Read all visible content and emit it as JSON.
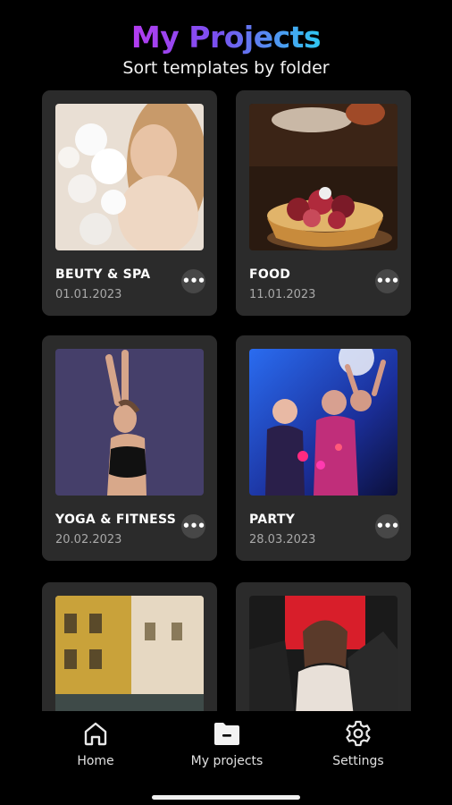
{
  "header": {
    "title": "My Projects",
    "subtitle": "Sort templates by folder"
  },
  "projects": [
    {
      "name": "BEUTY & SPA",
      "date": "01.01.2023",
      "more_icon": "more-horizontal-icon"
    },
    {
      "name": "FOOD",
      "date": "11.01.2023",
      "more_icon": "more-horizontal-icon"
    },
    {
      "name": "YOGA & FITNESS",
      "date": "20.02.2023",
      "more_icon": "more-horizontal-icon"
    },
    {
      "name": "PARTY",
      "date": "28.03.2023",
      "more_icon": "more-horizontal-icon"
    },
    {
      "name": "",
      "date": ""
    },
    {
      "name": "",
      "date": ""
    }
  ],
  "more_glyph": "•••",
  "bottom_nav": {
    "items": [
      {
        "label": "Home",
        "icon": "home-icon"
      },
      {
        "label": "My projects",
        "icon": "folder-icon",
        "active": true
      },
      {
        "label": "Settings",
        "icon": "gear-icon"
      }
    ]
  },
  "colors": {
    "background": "#000000",
    "card": "#2b2b2b",
    "title_gradient_start": "#b43cf0",
    "title_gradient_end": "#2fc9f2"
  }
}
